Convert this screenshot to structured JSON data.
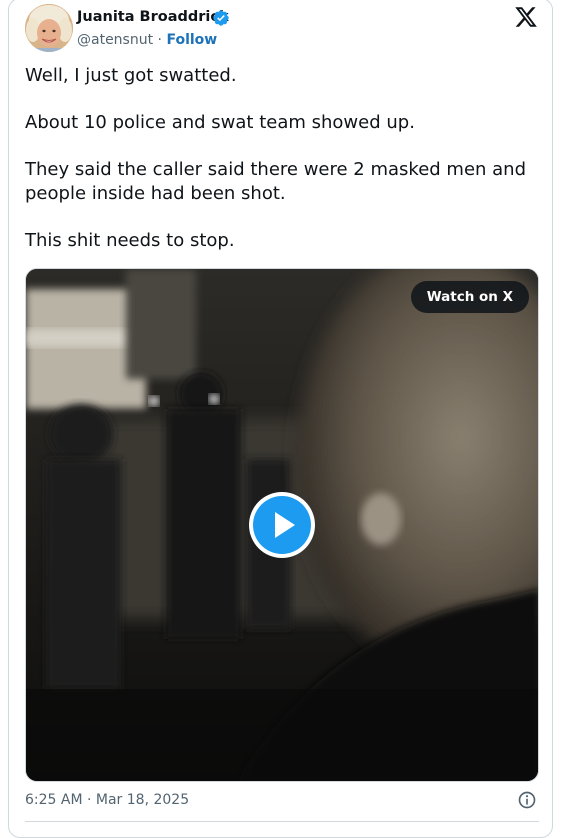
{
  "author": {
    "display_name": "Juanita Broaddrick",
    "handle": "@atensnut",
    "separator": "·",
    "follow_label": "Follow",
    "verified": true,
    "avatar_icon": "profile-photo"
  },
  "brand_icon": "x-logo-icon",
  "tweet": {
    "paragraphs": [
      "Well, I just got swatted.",
      "About 10 police and swat team showed up.",
      "They said the caller said there were 2 masked men and people inside had been shot.",
      "This shit needs to stop."
    ]
  },
  "media": {
    "type": "video",
    "watch_label": "Watch on X",
    "play_icon": "play-icon"
  },
  "footer": {
    "timestamp": "6:25 AM · Mar 18, 2025",
    "info_icon": "info-icon"
  },
  "colors": {
    "text": "#0f1419",
    "secondary": "#536471",
    "link": "#1d72b8",
    "verified_blue": "#1d9bf0",
    "border": "#cfd9de"
  }
}
